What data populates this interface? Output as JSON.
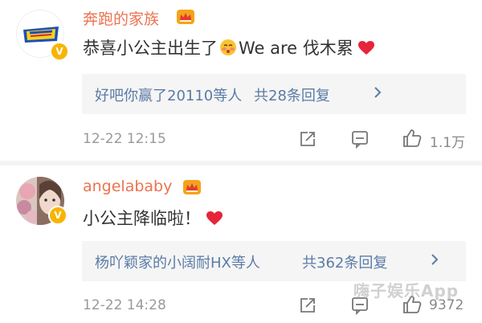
{
  "comments": [
    {
      "user_name": "奔跑的家族",
      "avatar_label": "RUNNING MAN",
      "text_before": "恭喜小公主出生了",
      "text_after": "We are 伐木累",
      "replies_users": "好吧你赢了20110等人",
      "replies_count": "共28条回复",
      "time": "12-22 12:15",
      "likes": "1.1万"
    },
    {
      "user_name": "angelababy",
      "text": "小公主降临啦！",
      "replies_users": "杨吖颖家的小阔耐HX等人",
      "replies_count": "共362条回复",
      "time": "12-22 14:28",
      "likes": "9372"
    }
  ],
  "watermark": "嗨子娱乐App",
  "colors": {
    "name": "#eb7350",
    "link": "#5b7ba6",
    "badge": "#f8b400",
    "heart": "#e6243a"
  },
  "icons": [
    "verified-badge-icon",
    "vip-crown-icon",
    "blush-emoji-icon",
    "heart-icon",
    "share-icon",
    "comment-icon",
    "like-icon",
    "chevron-right-icon"
  ]
}
